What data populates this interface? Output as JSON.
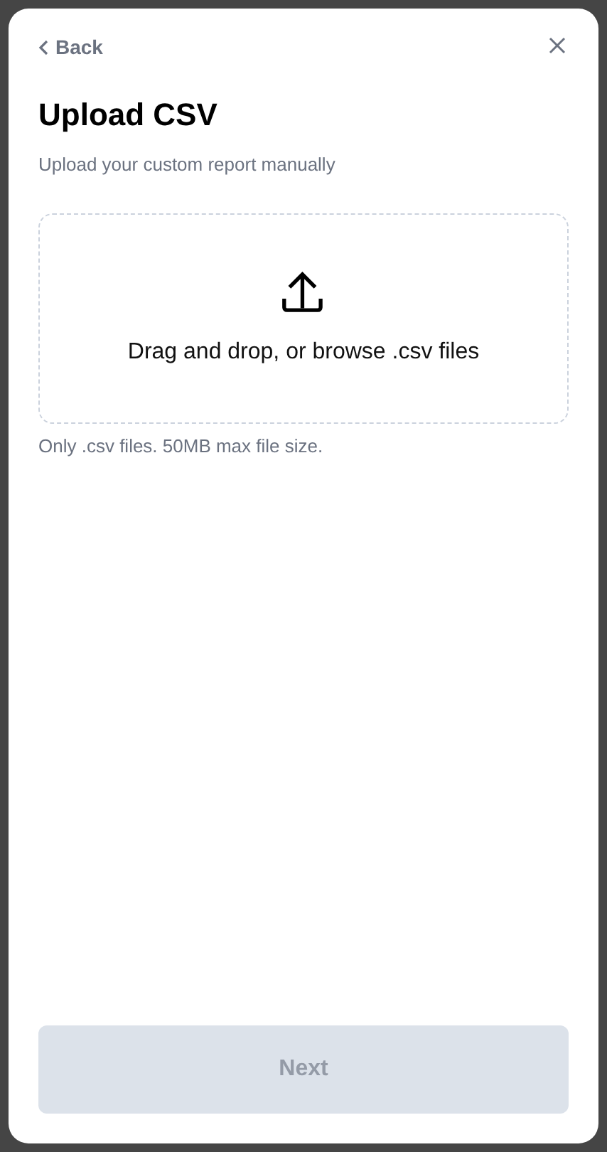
{
  "header": {
    "back_label": "Back"
  },
  "title": "Upload CSV",
  "subtitle": "Upload your custom report manually",
  "dropzone": {
    "label": "Drag and drop, or browse .csv files"
  },
  "hint": "Only .csv files. 50MB max file size.",
  "next_button": {
    "label": "Next",
    "disabled": true
  }
}
